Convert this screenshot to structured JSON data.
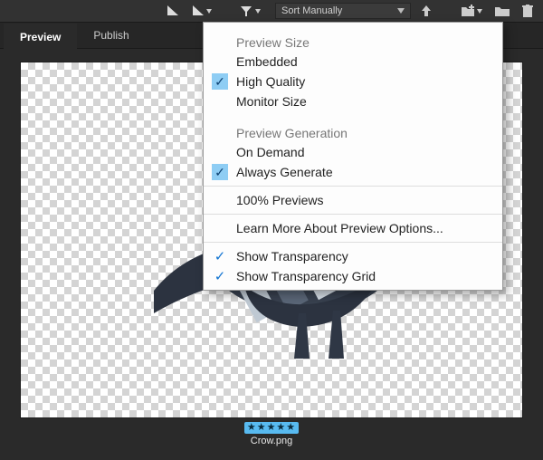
{
  "toolbar": {
    "sort_label": "Sort Manually"
  },
  "tabs": {
    "preview": "Preview",
    "publish": "Publish"
  },
  "menu": {
    "section_preview_size": "Preview Size",
    "embedded": "Embedded",
    "high_quality": "High Quality",
    "monitor_size": "Monitor Size",
    "section_preview_generation": "Preview Generation",
    "on_demand": "On Demand",
    "always_generate": "Always Generate",
    "hundred_percent": "100% Previews",
    "learn_more": "Learn More About Preview Options...",
    "show_transparency": "Show Transparency",
    "show_transparency_grid": "Show Transparency Grid"
  },
  "file": {
    "stars": "★★★★★",
    "name": "Crow.png"
  }
}
